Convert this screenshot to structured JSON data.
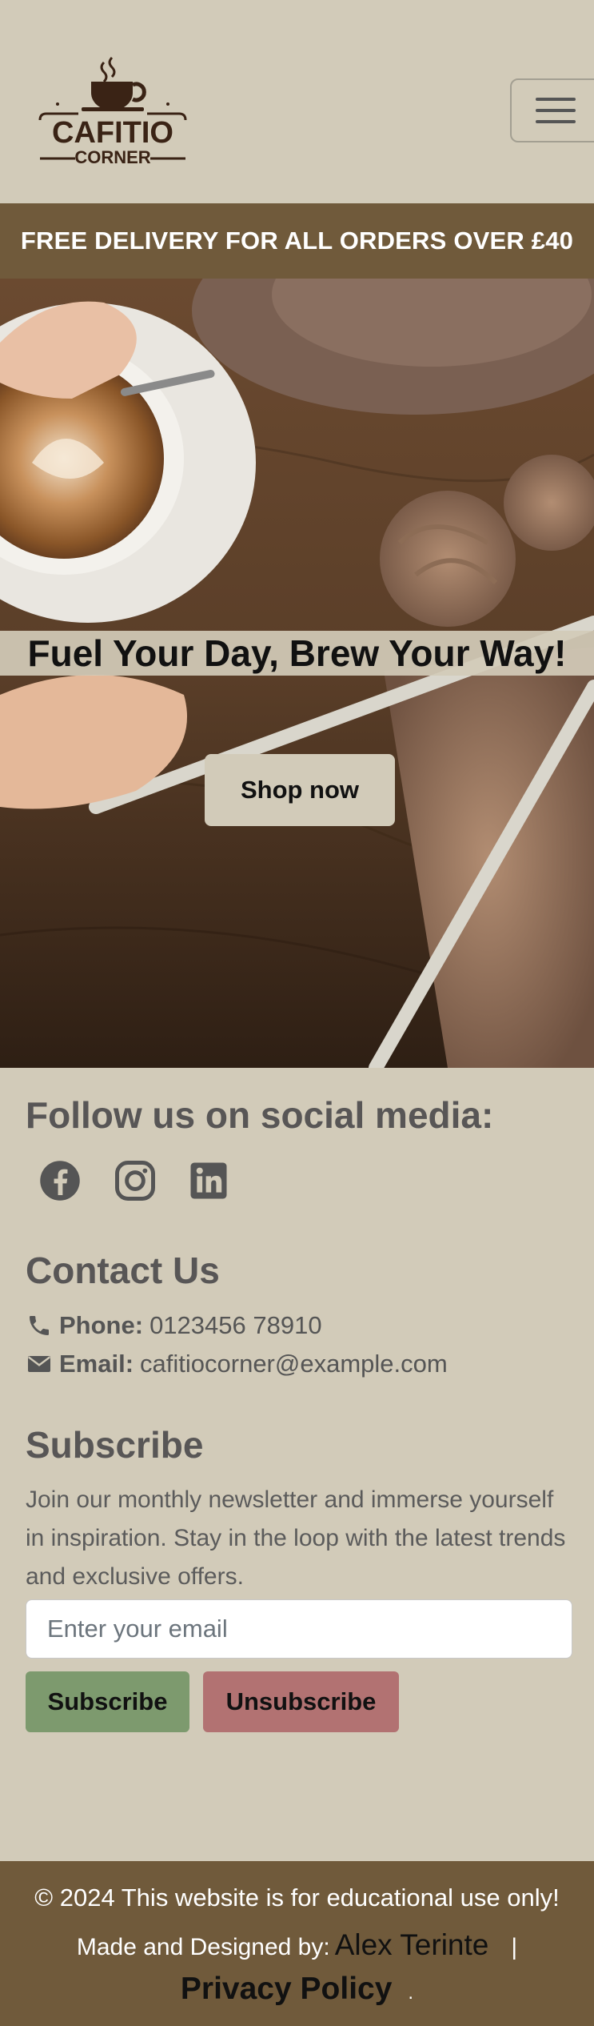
{
  "header": {
    "logo": {
      "top_text": "CAFITIO",
      "bottom_text": "CORNER"
    },
    "menu_icon": "hamburger-icon"
  },
  "promo": {
    "text": "FREE DELIVERY FOR ALL ORDERS OVER £40"
  },
  "hero": {
    "title": "Fuel Your Day, Brew Your Way!",
    "button": "Shop now"
  },
  "social": {
    "heading": "Follow us on social media:",
    "icons": [
      "facebook-icon",
      "instagram-icon",
      "linkedin-icon"
    ]
  },
  "contact": {
    "heading": "Contact Us",
    "phone_label": "Phone:",
    "phone_value": "0123456 78910",
    "email_label": "Email:",
    "email_value": "cafitiocorner@example.com"
  },
  "subscribe": {
    "heading": "Subscribe",
    "text": "Join our monthly newsletter and immerse yourself in inspiration. Stay in the loop with the latest trends and exclusive offers.",
    "placeholder": "Enter your email",
    "subscribe_button": "Subscribe",
    "unsubscribe_button": "Unsubscribe"
  },
  "footer": {
    "copyright": "© 2024 This website is for educational use only!",
    "made_by": "Made and Designed by:",
    "author": "Alex Terinte",
    "separator": "|",
    "privacy": "Privacy Policy",
    "dot": "."
  },
  "colors": {
    "background": "#d2cbb9",
    "brand_brown": "#705a3b",
    "subscribe_green": "#7d9a6e",
    "unsubscribe_red": "#b27272"
  }
}
